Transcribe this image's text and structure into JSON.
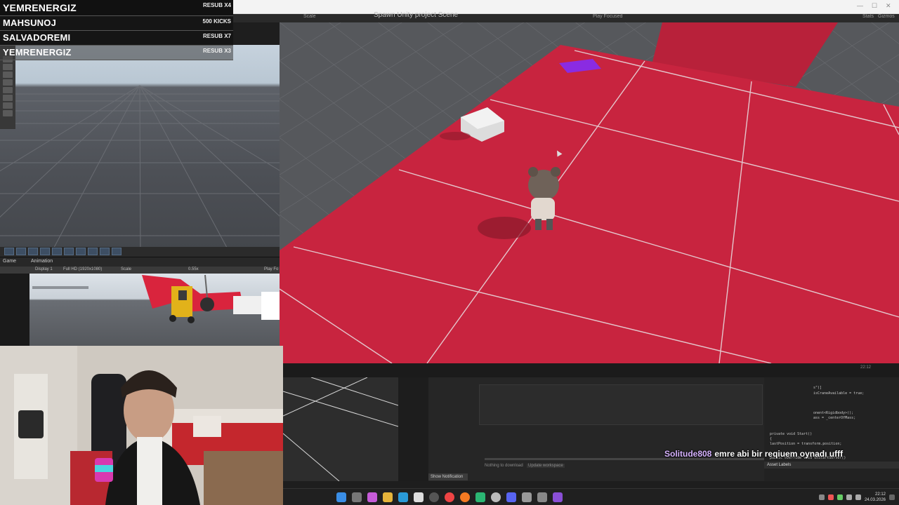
{
  "leaderboard": [
    {
      "name": "YEMRENERGIZ",
      "badge": "RESUB X4"
    },
    {
      "name": "MAHSUNOJ",
      "badge": "500 KICKS"
    },
    {
      "name": "SALVADOREMI",
      "badge": "RESUB X7"
    },
    {
      "name": "YEMRENERGIZ",
      "badge": "RESUB X3"
    }
  ],
  "game_panel": {
    "tabs": [
      "Game",
      "Animation"
    ],
    "display": "Display 1",
    "resolution": "Full HD (1920x1080)",
    "scale_label": "Scale",
    "scale_value": "0.55x",
    "play_label": "Play Fo"
  },
  "editor_header": {
    "title": "Spawn Unity project Scene",
    "scale_label": "Scale",
    "play_focused": "Play Focused",
    "stats": "Stats",
    "gizmos": "Gizmos"
  },
  "lower_panel": {
    "show_notification": "Show Notification",
    "nothing_to_download": "Nothing to download",
    "update_workspace": "Update workspace",
    "asset_labels": "Asset Labels"
  },
  "code_lines": [
    "s\")]",
    "isCraneAvailable = true;",
    "onent<Rigidbody>();",
    "ass = _centerOfMass;",
    "private void Start()",
    "{",
    "  lastPosition = transform.position;",
    "  public override void OnStartServer()"
  ],
  "chat": {
    "user": "Solitude808",
    "message": "emre abi bir reqiuem oynadı ufff"
  },
  "taskbar": {
    "time": "22:12",
    "date": "24.03.2026"
  },
  "colors": {
    "floor_red": "#c8243f",
    "chat_user": "#d7b3ff",
    "cube_purple": "#8a2be2"
  }
}
